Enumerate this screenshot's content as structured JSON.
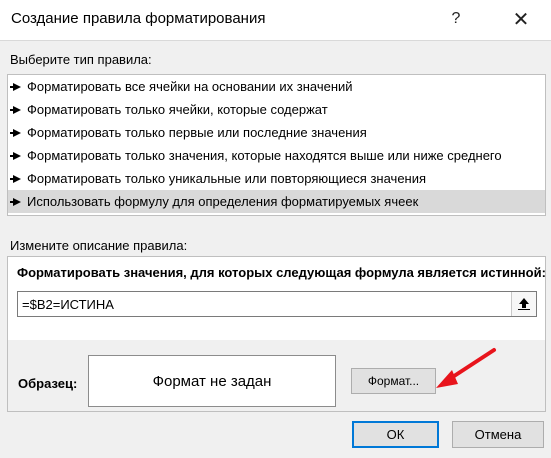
{
  "dialog": {
    "title": "Создание правила форматирования",
    "help_glyph": "?",
    "close_glyph": "✕"
  },
  "rule_type": {
    "label": "Выберите тип правила:",
    "items": [
      "Форматировать все ячейки на основании их значений",
      "Форматировать только ячейки, которые содержат",
      "Форматировать только первые или последние значения",
      "Форматировать только значения, которые находятся выше или ниже среднего",
      "Форматировать только уникальные или повторяющиеся значения",
      "Использовать формулу для определения форматируемых ячеек"
    ],
    "selected_index": 5
  },
  "description": {
    "label": "Измените описание правила:",
    "formula_heading": "Форматировать значения, для которых следующая формула является истинной:",
    "formula_value": "=$B2=ИСТИНА"
  },
  "sample": {
    "label": "Образец:",
    "preview_text": "Формат не задан",
    "format_button": "Формат..."
  },
  "buttons": {
    "ok": "ОК",
    "cancel": "Отмена"
  },
  "colors": {
    "accent": "#0078d7",
    "annotation_arrow": "#e8141c",
    "selected_row": "#d9d9d9"
  }
}
